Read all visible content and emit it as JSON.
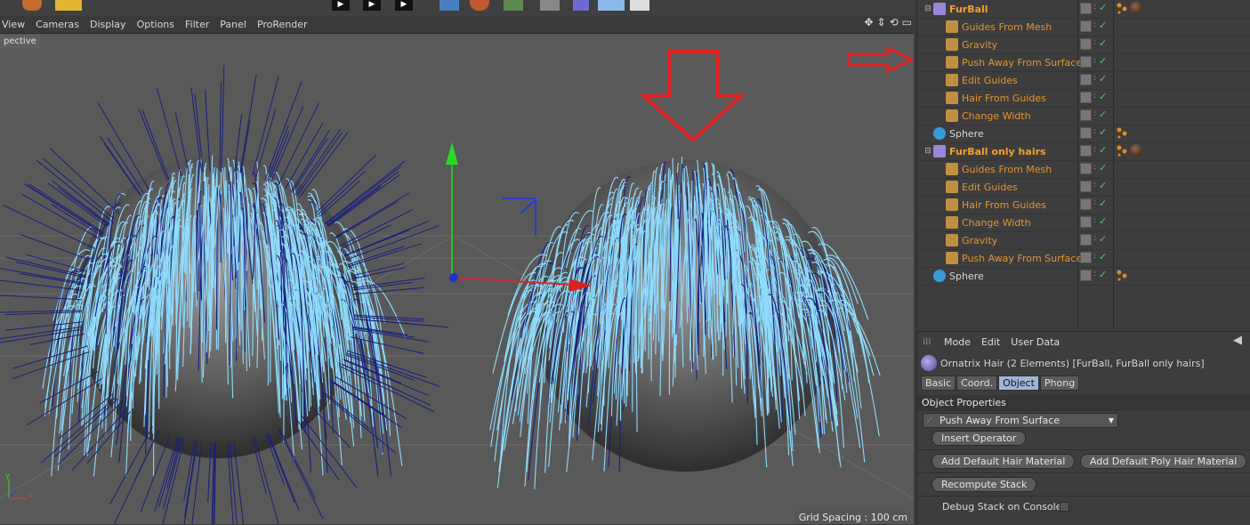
{
  "viewport": {
    "menu": [
      "View",
      "Cameras",
      "Display",
      "Options",
      "Filter",
      "Panel",
      "ProRender"
    ],
    "camera_label": "pective",
    "grid_spacing": "Grid Spacing : 100 cm"
  },
  "object_manager": {
    "rows": [
      {
        "name": "FurBall",
        "kind": "group",
        "level": 0,
        "style": "bold",
        "tags": [
          "dots",
          "material"
        ]
      },
      {
        "name": "Guides From Mesh",
        "kind": "op",
        "level": 1,
        "style": "orange",
        "tags": []
      },
      {
        "name": "Gravity",
        "kind": "op",
        "level": 1,
        "style": "orange",
        "tags": []
      },
      {
        "name": "Push Away From Surface",
        "kind": "op",
        "level": 1,
        "style": "orange",
        "tags": []
      },
      {
        "name": "Edit Guides",
        "kind": "op",
        "level": 1,
        "style": "orange",
        "tags": []
      },
      {
        "name": "Hair From Guides",
        "kind": "op",
        "level": 1,
        "style": "orange",
        "tags": []
      },
      {
        "name": "Change Width",
        "kind": "op",
        "level": 1,
        "style": "orange",
        "tags": []
      },
      {
        "name": "Sphere",
        "kind": "sphere",
        "level": 0,
        "style": "white",
        "tags": [
          "dots"
        ]
      },
      {
        "name": "FurBall only hairs",
        "kind": "group",
        "level": 0,
        "style": "bold",
        "tags": [
          "dots",
          "material"
        ]
      },
      {
        "name": "Guides From Mesh",
        "kind": "op",
        "level": 1,
        "style": "orange",
        "tags": []
      },
      {
        "name": "Edit Guides",
        "kind": "op",
        "level": 1,
        "style": "orange",
        "tags": []
      },
      {
        "name": "Hair From Guides",
        "kind": "op",
        "level": 1,
        "style": "orange",
        "tags": []
      },
      {
        "name": "Change Width",
        "kind": "op",
        "level": 1,
        "style": "orange",
        "tags": []
      },
      {
        "name": "Gravity",
        "kind": "op",
        "level": 1,
        "style": "orange",
        "tags": []
      },
      {
        "name": "Push Away From Surface",
        "kind": "op",
        "level": 1,
        "style": "orange",
        "tags": []
      },
      {
        "name": "Sphere",
        "kind": "sphere",
        "level": 0,
        "style": "white",
        "tags": [
          "dots"
        ]
      }
    ]
  },
  "attribute_manager": {
    "menu": [
      "Mode",
      "Edit",
      "User Data"
    ],
    "title": "Ornatrix Hair (2 Elements) [FurBall, FurBall only hairs]",
    "tabs": [
      {
        "label": "Basic",
        "active": false
      },
      {
        "label": "Coord.",
        "active": false
      },
      {
        "label": "Object",
        "active": true
      },
      {
        "label": "Phong",
        "active": false
      }
    ],
    "section": "Object Properties",
    "operator_dropdown": "Push Away From Surface",
    "insert_operator": "Insert Operator",
    "add_hair_material": "Add Default Hair Material",
    "add_poly_hair_material": "Add Default Poly Hair Material",
    "recompute_stack": "Recompute Stack",
    "debug_stack": "Debug Stack on Console",
    "debug_stack_checked": false
  },
  "colors": {
    "hair_light": "#8fdcff",
    "hair_dark": "#1a1f7a",
    "arrow_red": "#e02020",
    "object_name_orange": "#e8922a",
    "tab_active": "#9cb7d8"
  }
}
